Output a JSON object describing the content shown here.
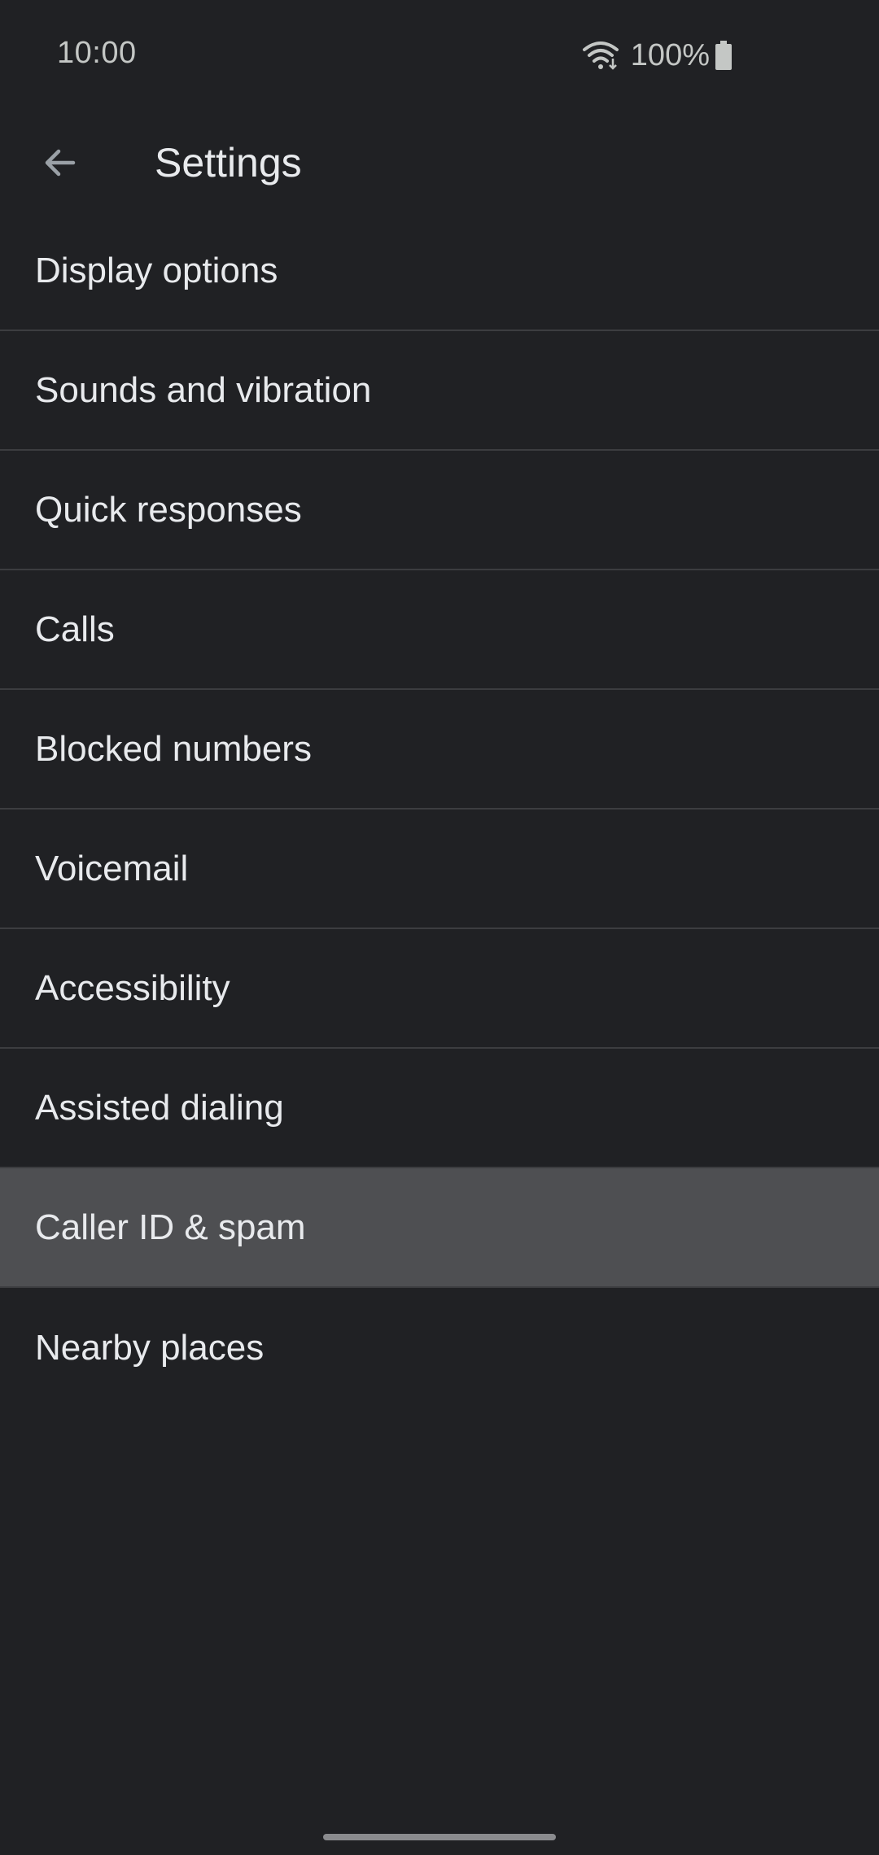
{
  "status_bar": {
    "time": "10:00",
    "battery_percent": "100%",
    "icons": [
      "wifi-icon",
      "battery-icon"
    ]
  },
  "app_bar": {
    "title": "Settings",
    "back_icon": "arrow-back-icon"
  },
  "settings": {
    "items": [
      {
        "label": "Display options"
      },
      {
        "label": "Sounds and vibration"
      },
      {
        "label": "Quick responses"
      },
      {
        "label": "Calls"
      },
      {
        "label": "Blocked numbers"
      },
      {
        "label": "Voicemail"
      },
      {
        "label": "Accessibility"
      },
      {
        "label": "Assisted dialing"
      },
      {
        "label": "Caller ID & spam"
      },
      {
        "label": "Nearby places"
      }
    ],
    "selected_index": 8
  },
  "colors": {
    "background": "#202124",
    "selected_row": "#4e4f52",
    "divider": "#3c3d40",
    "text_primary": "#e8eaed"
  }
}
